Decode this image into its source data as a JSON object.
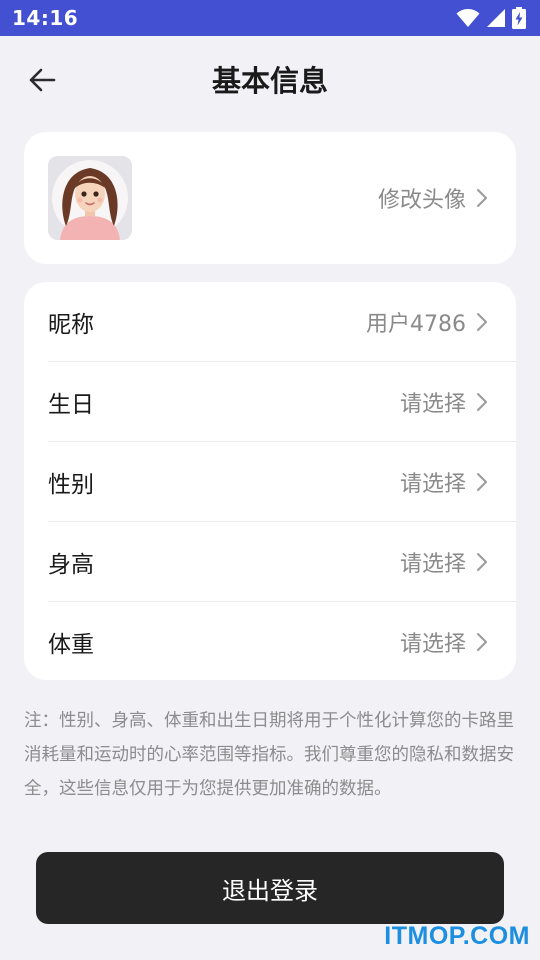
{
  "status_bar": {
    "time": "14:16",
    "wifi_icon": "wifi-icon",
    "signal_icon": "signal-icon",
    "battery_icon": "battery-charging-icon"
  },
  "header": {
    "title": "基本信息",
    "back_icon": "arrow-left-icon"
  },
  "avatar_card": {
    "change_label": "修改头像",
    "chevron_icon": "chevron-right-icon"
  },
  "info_rows": [
    {
      "label": "昵称",
      "value": "用户4786"
    },
    {
      "label": "生日",
      "value": "请选择"
    },
    {
      "label": "性别",
      "value": "请选择"
    },
    {
      "label": "身高",
      "value": "请选择"
    },
    {
      "label": "体重",
      "value": "请选择"
    }
  ],
  "note": "注：性别、身高、体重和出生日期将用于个性化计算您的卡路里消耗量和运动时的心率范围等指标。我们尊重您的隐私和数据安全，这些信息仅用于为您提供更加准确的数据。",
  "logout_label": "退出登录",
  "watermark": "ITMOP.COM",
  "colors": {
    "status_bar": "#4450d2",
    "background": "#f2f1f6",
    "button": "#262626",
    "watermark": "#1c8fe0"
  }
}
